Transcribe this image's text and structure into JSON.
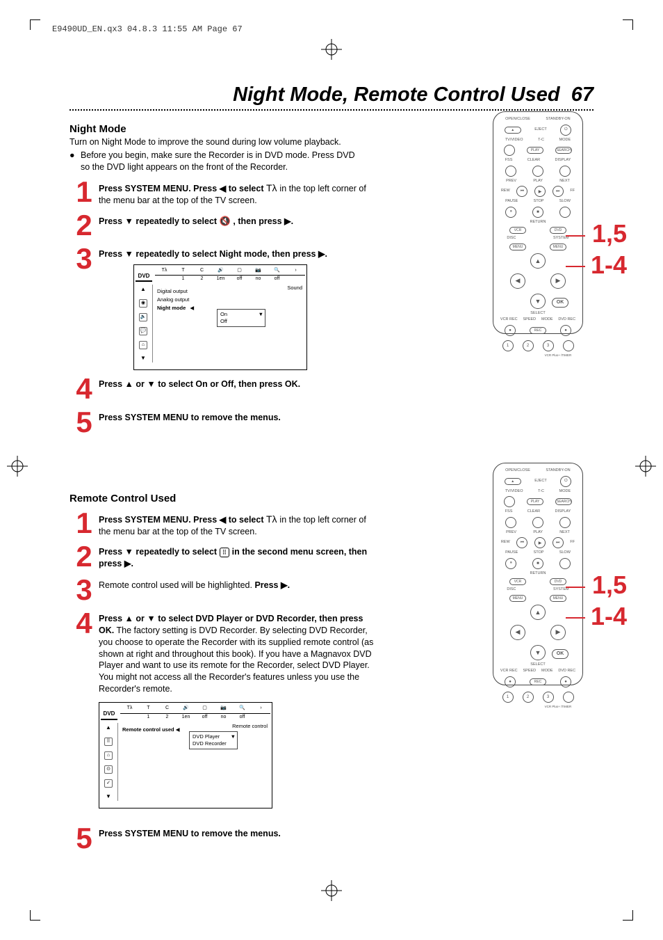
{
  "meta": {
    "header": "E9490UD_EN.qx3  04.8.3  11:55 AM  Page 67"
  },
  "title": {
    "text": "Night Mode, Remote Control Used",
    "page": "67"
  },
  "nightMode": {
    "heading": "Night Mode",
    "intro": "Turn on Night Mode to improve the sound during low volume playback.",
    "bullet": "Before you begin, make sure the Recorder is in DVD mode. Press DVD so the DVD light appears on the front of the Recorder.",
    "steps": {
      "s1a": "Press SYSTEM MENU. Press ◀ to select",
      "s1b": "in the top left corner of the menu bar at the top of the TV screen.",
      "s2a": "Press ▼ repeatedly to select",
      "s2b": ", then press ▶.",
      "s3": "Press ▼ repeatedly to select Night mode, then press ▶.",
      "s4": "Press ▲ or ▼ to select On or Off, then press OK.",
      "s5": "Press SYSTEM MENU to remove the menus."
    },
    "osd": {
      "tabVals": [
        "1",
        "2",
        "1en",
        "off",
        "no",
        "off"
      ],
      "panelTitle": "Sound",
      "items": [
        "Digital output",
        "Analog output",
        "Night mode"
      ],
      "options": [
        "On",
        "Off"
      ]
    }
  },
  "remoteUsed": {
    "heading": "Remote Control Used",
    "steps": {
      "s1a": "Press SYSTEM MENU. Press ◀ to select",
      "s1b": "in the top left corner of the menu bar at the top of the TV screen.",
      "s2a": "Press ▼ repeatedly to select",
      "s2b": "in the second menu screen, then press ▶.",
      "s3a": "Remote control used will be highlighted.",
      "s3b": "Press ▶.",
      "s4a": "Press ▲ or ▼ to select DVD Player or DVD Recorder, then press OK.",
      "s4b": "The factory setting is DVD Recorder. By selecting DVD Recorder, you choose to operate the Recorder with its supplied remote control (as shown at right and throughout this book). If you have a Magnavox DVD Player and want to use its remote for the Recorder, select DVD Player. You might not access all the Recorder's features unless you use the Recorder's remote.",
      "s5": "Press SYSTEM MENU to remove the menus."
    },
    "osd": {
      "tabVals": [
        "1",
        "2",
        "1en",
        "off",
        "no",
        "off"
      ],
      "panelTitle": "Remote control",
      "item": "Remote control used",
      "options": [
        "DVD Player",
        "DVD Recorder"
      ]
    }
  },
  "remoteDiagram": {
    "labels": {
      "standby": "STANDBY-ON",
      "openclose": "OPEN/CLOSE",
      "eject": "EJECT",
      "tvvideo": "TV/VIDEO",
      "tc": "T-C",
      "mode": "MODE",
      "play": "PLAY",
      "search": "SEARCH",
      "fss": "FSS",
      "clear": "CLEAR",
      "display": "DISPLAY",
      "prev": "PREV",
      "playc": "PLAY",
      "next": "NEXT",
      "rew": "REW",
      "ff": "FF",
      "pause": "PAUSE",
      "stop": "STOP",
      "slow": "SLOW",
      "return": "RETURN",
      "vcr": "VCR",
      "dvd": "DVD",
      "disc": "DISC",
      "system": "SYSTEM",
      "menu": "MENU",
      "select": "SELECT",
      "ok": "OK",
      "vcrrec": "VCR REC",
      "speed": "SPEED",
      "moder": "MODE",
      "dvdrec": "DVD REC",
      "rec": "REC",
      "vcrplus": "VCR Plus+ /TIMER",
      "n1": "1",
      "n2": "2",
      "n3": "3"
    }
  },
  "callouts": {
    "a": "1,5",
    "b": "1-4"
  }
}
